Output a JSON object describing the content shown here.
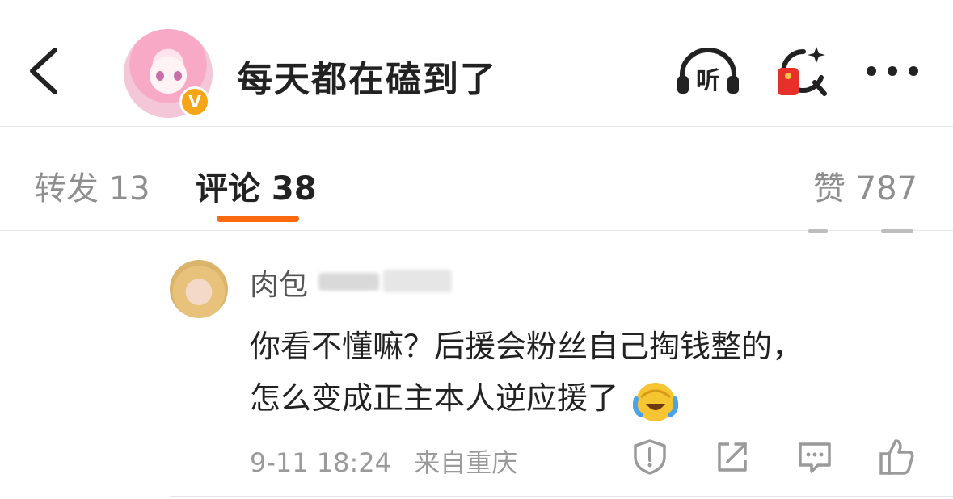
{
  "header": {
    "title": "每天都在磕到了",
    "listen_label": "听",
    "verified_mark": "V"
  },
  "tabs": {
    "repost": "转发 13",
    "comment": "评论 38",
    "like": "赞 787"
  },
  "comment": {
    "author_visible": "肉包",
    "line1": "你看不懂嘛？后援会粉丝自己掏钱整的，",
    "line2": "怎么变成正主本人逆应援了",
    "emoji": "laughing-crying-emoji",
    "time": "9-11 18:24",
    "location": "来自重庆"
  },
  "icons": [
    "back-arrow-icon",
    "headphones-icon",
    "red-packet-search-icon",
    "more-icon",
    "report-icon",
    "share-icon",
    "reply-icon",
    "like-icon"
  ],
  "colors": {
    "accent": "#ff6a0f",
    "verified": "#f6a516",
    "red_packet": "#e8302a"
  }
}
